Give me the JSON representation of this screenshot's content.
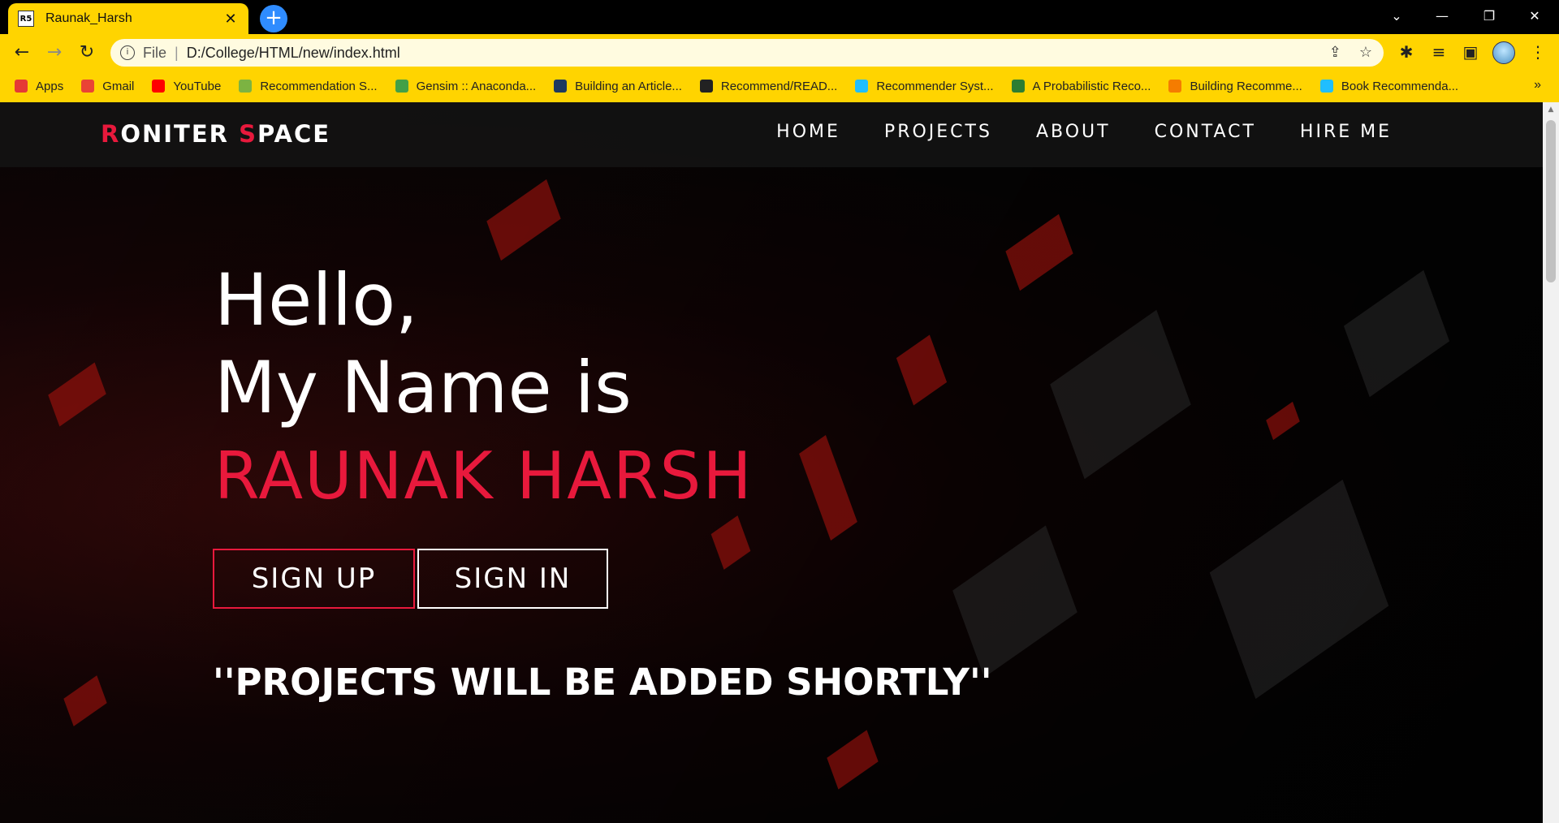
{
  "browser": {
    "tab": {
      "favicon_text": "R5",
      "title": "Raunak_Harsh",
      "close": "✕"
    },
    "new_tab": "+",
    "window_controls": {
      "list": "⌄",
      "minimize": "—",
      "restore": "❐",
      "close": "✕"
    },
    "nav": {
      "back": "←",
      "forward": "→",
      "reload": "↻"
    },
    "address": {
      "info": "i",
      "scheme": "File",
      "separator": "|",
      "url": "D:/College/HTML/new/index.html"
    },
    "address_actions": {
      "share": "⇪",
      "star": "☆"
    },
    "extensions": {
      "puzzle": "✱",
      "reading_list": "≡",
      "sidebar": "▣",
      "menu": "⋮"
    },
    "colors": {
      "chrome": "#ffd400",
      "omnibox": "#fffbe0"
    },
    "bookmarks": [
      {
        "label": "Apps",
        "icon": "apps-grid-icon",
        "color": "#e53935"
      },
      {
        "label": "Gmail",
        "icon": "gmail-icon",
        "color": "#ea4335"
      },
      {
        "label": "YouTube",
        "icon": "youtube-icon",
        "color": "#ff0000"
      },
      {
        "label": "Recommendation S...",
        "icon": "recommendation-icon",
        "color": "#7cb342"
      },
      {
        "label": "Gensim :: Anaconda...",
        "icon": "anaconda-icon",
        "color": "#43a047"
      },
      {
        "label": "Building an Article...",
        "icon": "tds-icon",
        "color": "#1e3a5f"
      },
      {
        "label": "Recommend/READ...",
        "icon": "github-icon",
        "color": "#222222"
      },
      {
        "label": "Recommender Syst...",
        "icon": "kaggle-icon",
        "color": "#20beff"
      },
      {
        "label": "A Probabilistic Reco...",
        "icon": "probabilistic-icon",
        "color": "#2e7d32"
      },
      {
        "label": "Building Recomme...",
        "icon": "building-icon",
        "color": "#f57c00"
      },
      {
        "label": "Book Recommenda...",
        "icon": "kaggle-icon",
        "color": "#20beff"
      }
    ],
    "bookmarks_more": "»"
  },
  "site": {
    "logo": {
      "first_initial": "R",
      "first_rest": "ONITER ",
      "second_initial": "S",
      "second_rest": "PACE"
    },
    "menu": [
      "HOME",
      "PROJECTS",
      "ABOUT",
      "CONTACT",
      "HIRE ME"
    ],
    "hero": {
      "line1": "Hello,",
      "line2": "My Name is",
      "name": "RAUNAK HARSH"
    },
    "buttons": {
      "signup": "SIGN UP",
      "signin": "SIGN IN"
    },
    "tagline": "''PROJECTS WILL BE ADDED SHORTLY''",
    "colors": {
      "accent": "#e8193c",
      "background": "#050505"
    }
  }
}
